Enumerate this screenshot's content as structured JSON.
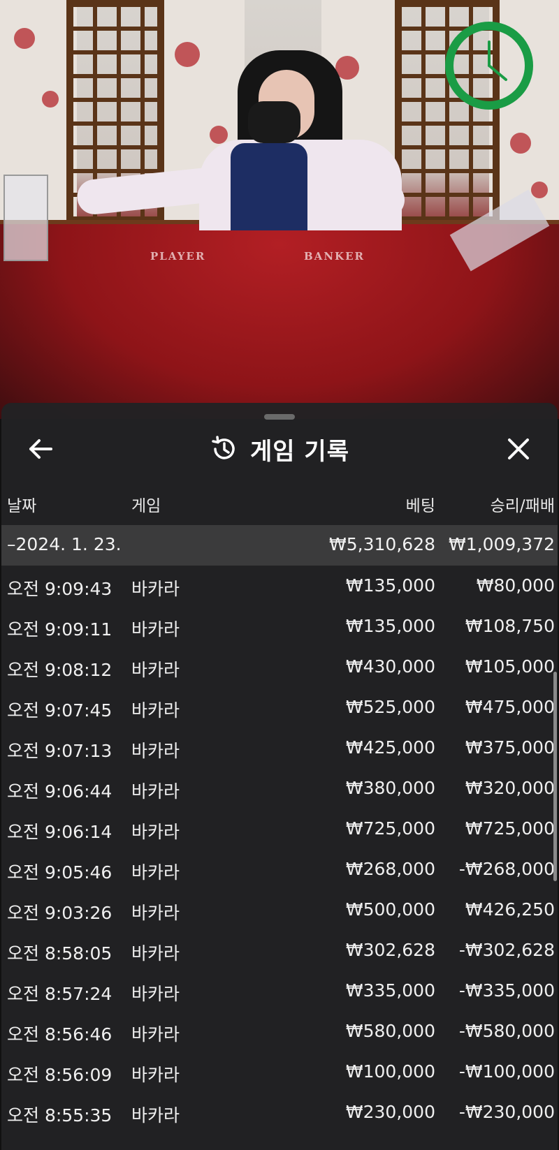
{
  "video": {
    "felt_labels": {
      "player": "PLAYER",
      "banker": "BANKER"
    },
    "timer": {
      "icon": "clock-icon",
      "color": "#1a9c45"
    }
  },
  "sheet": {
    "title": "게임 기록",
    "title_icon": "history-icon",
    "back_icon": "arrow-left-icon",
    "close_icon": "close-icon",
    "columns": {
      "date": "날짜",
      "game": "게임",
      "bet": "베팅",
      "result": "승리/패배"
    },
    "summary": {
      "date": "–2024. 1. 23.",
      "bet": "₩5,310,628",
      "result": "₩1,009,372"
    },
    "rows": [
      {
        "time": "오전 9:09:43",
        "game": "바카라",
        "bet": "₩135,000",
        "result": "₩80,000"
      },
      {
        "time": "오전 9:09:11",
        "game": "바카라",
        "bet": "₩135,000",
        "result": "₩108,750"
      },
      {
        "time": "오전 9:08:12",
        "game": "바카라",
        "bet": "₩430,000",
        "result": "₩105,000"
      },
      {
        "time": "오전 9:07:45",
        "game": "바카라",
        "bet": "₩525,000",
        "result": "₩475,000"
      },
      {
        "time": "오전 9:07:13",
        "game": "바카라",
        "bet": "₩425,000",
        "result": "₩375,000"
      },
      {
        "time": "오전 9:06:44",
        "game": "바카라",
        "bet": "₩380,000",
        "result": "₩320,000"
      },
      {
        "time": "오전 9:06:14",
        "game": "바카라",
        "bet": "₩725,000",
        "result": "₩725,000"
      },
      {
        "time": "오전 9:05:46",
        "game": "바카라",
        "bet": "₩268,000",
        "result": "-₩268,000"
      },
      {
        "time": "오전 9:03:26",
        "game": "바카라",
        "bet": "₩500,000",
        "result": "₩426,250"
      },
      {
        "time": "오전 8:58:05",
        "game": "바카라",
        "bet": "₩302,628",
        "result": "-₩302,628"
      },
      {
        "time": "오전 8:57:24",
        "game": "바카라",
        "bet": "₩335,000",
        "result": "-₩335,000"
      },
      {
        "time": "오전 8:56:46",
        "game": "바카라",
        "bet": "₩580,000",
        "result": "-₩580,000"
      },
      {
        "time": "오전 8:56:09",
        "game": "바카라",
        "bet": "₩100,000",
        "result": "-₩100,000"
      },
      {
        "time": "오전 8:55:35",
        "game": "바카라",
        "bet": "₩230,000",
        "result": "-₩230,000"
      }
    ]
  }
}
